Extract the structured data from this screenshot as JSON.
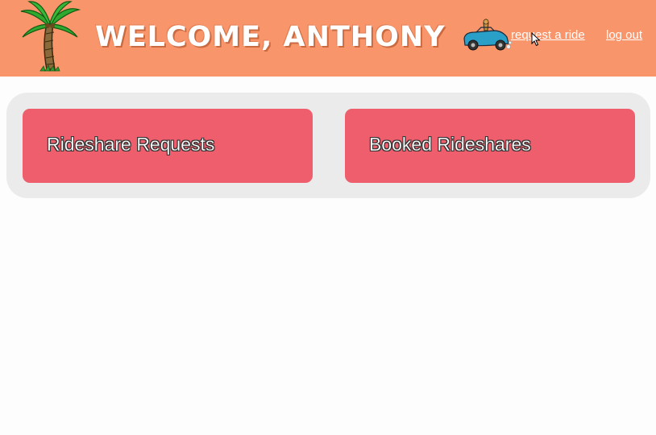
{
  "header": {
    "welcome_text": "WELCOME, ANTHONY",
    "logo_icon": "palm-tree-icon",
    "car_icon": "car-icon",
    "background_color": "#f9956a",
    "nav": {
      "request_ride_label": "request a ride",
      "logout_label": "log out"
    }
  },
  "main": {
    "panel_color": "#ebebeb",
    "card_color": "#ee5e6c",
    "cards": [
      {
        "label": "Rideshare Requests"
      },
      {
        "label": "Booked Rideshares"
      }
    ]
  }
}
